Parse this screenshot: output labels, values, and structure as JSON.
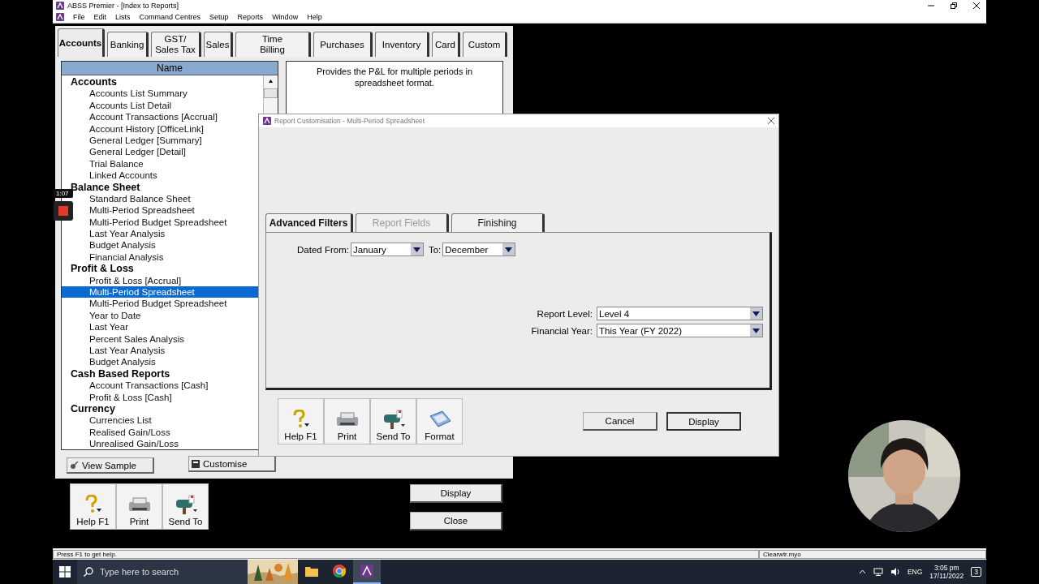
{
  "window": {
    "title": "ABSS Premier - [Index to Reports]",
    "menu": [
      "File",
      "Edit",
      "Lists",
      "Command Centres",
      "Setup",
      "Reports",
      "Window",
      "Help"
    ]
  },
  "recorder": {
    "time": "1:07"
  },
  "index_window": {
    "tabs": [
      {
        "label": "Accounts",
        "selected": true
      },
      {
        "label": "Banking",
        "selected": false
      },
      {
        "label": "GST/\nSales Tax",
        "selected": false
      },
      {
        "label": "Sales",
        "selected": false
      },
      {
        "label": "Time\nBilling",
        "selected": false
      },
      {
        "label": "Purchases",
        "selected": false
      },
      {
        "label": "Inventory",
        "selected": false
      },
      {
        "label": "Card",
        "selected": false
      },
      {
        "label": "Custom",
        "selected": false
      }
    ],
    "list": {
      "column": "Name",
      "groups": [
        {
          "label": "Accounts",
          "items": [
            {
              "label": "Accounts List Summary",
              "selected": false
            },
            {
              "label": "Accounts List Detail",
              "selected": false
            },
            {
              "label": "Account Transactions [Accrual]",
              "selected": false
            },
            {
              "label": "Account History [OfficeLink]",
              "selected": false
            },
            {
              "label": "General Ledger [Summary]",
              "selected": false
            },
            {
              "label": "General Ledger [Detail]",
              "selected": false
            },
            {
              "label": "Trial Balance",
              "selected": false
            },
            {
              "label": "Linked Accounts",
              "selected": false
            }
          ]
        },
        {
          "label": "Balance Sheet",
          "items": [
            {
              "label": "Standard Balance Sheet",
              "selected": false
            },
            {
              "label": "Multi-Period Spreadsheet",
              "selected": false
            },
            {
              "label": "Multi-Period Budget Spreadsheet",
              "selected": false
            },
            {
              "label": "Last Year Analysis",
              "selected": false
            },
            {
              "label": "Budget Analysis",
              "selected": false
            },
            {
              "label": "Financial Analysis",
              "selected": false
            }
          ]
        },
        {
          "label": "Profit & Loss",
          "items": [
            {
              "label": "Profit & Loss [Accrual]",
              "selected": false
            },
            {
              "label": "Multi-Period Spreadsheet",
              "selected": true
            },
            {
              "label": "Multi-Period Budget Spreadsheet",
              "selected": false
            },
            {
              "label": "Year to Date",
              "selected": false
            },
            {
              "label": "Last Year",
              "selected": false
            },
            {
              "label": "Percent Sales Analysis",
              "selected": false
            },
            {
              "label": "Last Year Analysis",
              "selected": false
            },
            {
              "label": "Budget Analysis",
              "selected": false
            }
          ]
        },
        {
          "label": "Cash Based Reports",
          "items": [
            {
              "label": "Account Transactions [Cash]",
              "selected": false
            },
            {
              "label": "Profit & Loss [Cash]",
              "selected": false
            }
          ]
        },
        {
          "label": "Currency",
          "items": [
            {
              "label": "Currencies List",
              "selected": false
            },
            {
              "label": "Realised Gain/Loss",
              "selected": false
            },
            {
              "label": "Unrealised Gain/Loss",
              "selected": false
            }
          ]
        }
      ]
    },
    "description": "Provides the P&L for multiple periods in spreadsheet format.",
    "view_sample": "View Sample",
    "customise": "Customise",
    "toolbar": [
      {
        "label": "Help F1",
        "kind": "help"
      },
      {
        "label": "Print",
        "kind": "print"
      },
      {
        "label": "Send To",
        "kind": "send"
      }
    ],
    "actions": [
      "Display",
      "Close"
    ]
  },
  "dialog": {
    "title": "Report Customisation - Multi-Period Spreadsheet",
    "tabs": [
      {
        "label": "Advanced Filters",
        "selected": true,
        "disabled": false
      },
      {
        "label": "Report Fields",
        "selected": false,
        "disabled": true
      },
      {
        "label": "Finishing",
        "selected": false,
        "disabled": false
      }
    ],
    "dated_from": {
      "label": "Dated From:",
      "value": "January"
    },
    "to": {
      "label": "To:",
      "value": "December"
    },
    "report_level": {
      "label": "Report Level:",
      "value": "Level 4"
    },
    "financial_year": {
      "label": "Financial Year:",
      "value": "This Year (FY 2022)"
    },
    "toolbar": [
      {
        "label": "Help F1",
        "kind": "help"
      },
      {
        "label": "Print",
        "kind": "print"
      },
      {
        "label": "Send To",
        "kind": "send"
      },
      {
        "label": "Format",
        "kind": "format"
      }
    ],
    "buttons": [
      "Cancel",
      "Display"
    ]
  },
  "status_bar": {
    "message": "Press F1 to get help.",
    "file": "Clearwtr.myo"
  },
  "taskbar": {
    "search_placeholder": "Type here to search",
    "apps": [
      {
        "kind": "explorer",
        "active": false
      },
      {
        "kind": "browser",
        "active": false
      },
      {
        "kind": "abss",
        "active": true
      }
    ],
    "language": "ENG",
    "time": "3:05 pm",
    "date": "17/11/2022",
    "notifications": "3"
  }
}
